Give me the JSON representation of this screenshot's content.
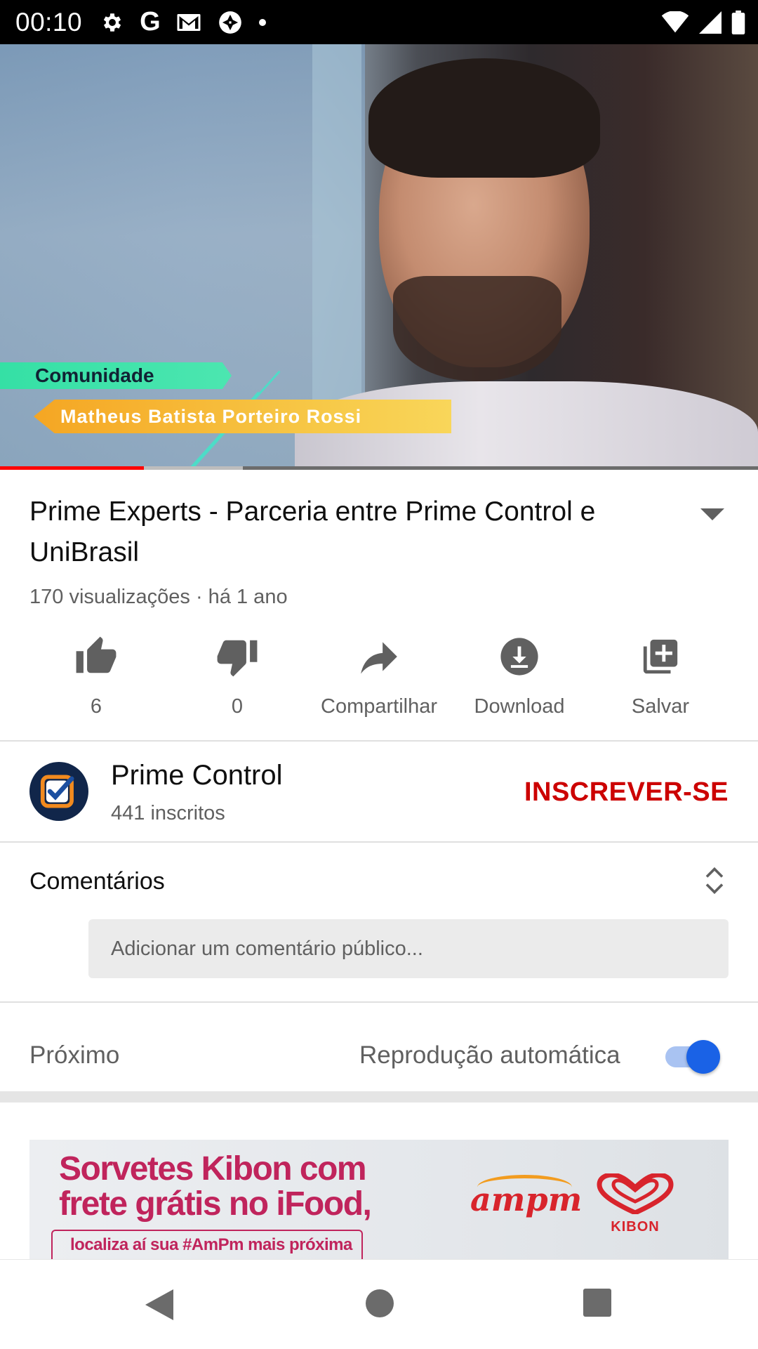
{
  "status_bar": {
    "time": "00:10",
    "left_icons": [
      "settings-icon",
      "google-icon",
      "gmail-icon",
      "camera-shutter-icon",
      "notification-dot-icon"
    ],
    "right_icons": [
      "wifi-icon",
      "cell-signal-icon",
      "battery-icon"
    ]
  },
  "video": {
    "overlay_label": "Comunidade",
    "overlay_name": "Matheus Batista Porteiro Rossi",
    "played_fraction": 0.19,
    "buffered_fraction": 0.32
  },
  "info": {
    "title": "Prime Experts - Parceria entre Prime Control e UniBrasil",
    "meta": "170 visualizações · há 1 ano"
  },
  "actions": [
    {
      "icon": "thumbs-up-icon",
      "label": "6"
    },
    {
      "icon": "thumbs-down-icon",
      "label": "0"
    },
    {
      "icon": "share-icon",
      "label": "Compartilhar"
    },
    {
      "icon": "download-icon",
      "label": "Download"
    },
    {
      "icon": "add-to-playlist-icon",
      "label": "Salvar"
    }
  ],
  "channel": {
    "name": "Prime Control",
    "subscribers": "441 inscritos",
    "subscribe_label": "INSCREVER-SE"
  },
  "comments": {
    "label": "Comentários",
    "placeholder": "Adicionar um comentário público..."
  },
  "up_next": {
    "label": "Próximo",
    "autoplay_label": "Reprodução automática",
    "autoplay_on": true
  },
  "ad": {
    "headline_line1": "Sorvetes Kibon com",
    "headline_line2": "frete grátis no iFood,",
    "subline": "localiza aí sua #AmPm mais próxima",
    "brand1": "ampm",
    "brand2": "KIBON"
  },
  "nav": [
    "back-icon",
    "home-icon",
    "recents-icon"
  ],
  "colors": {
    "accent_red": "#cc0000",
    "progress_red": "#ff0000",
    "toggle_blue": "#1a62e6"
  }
}
